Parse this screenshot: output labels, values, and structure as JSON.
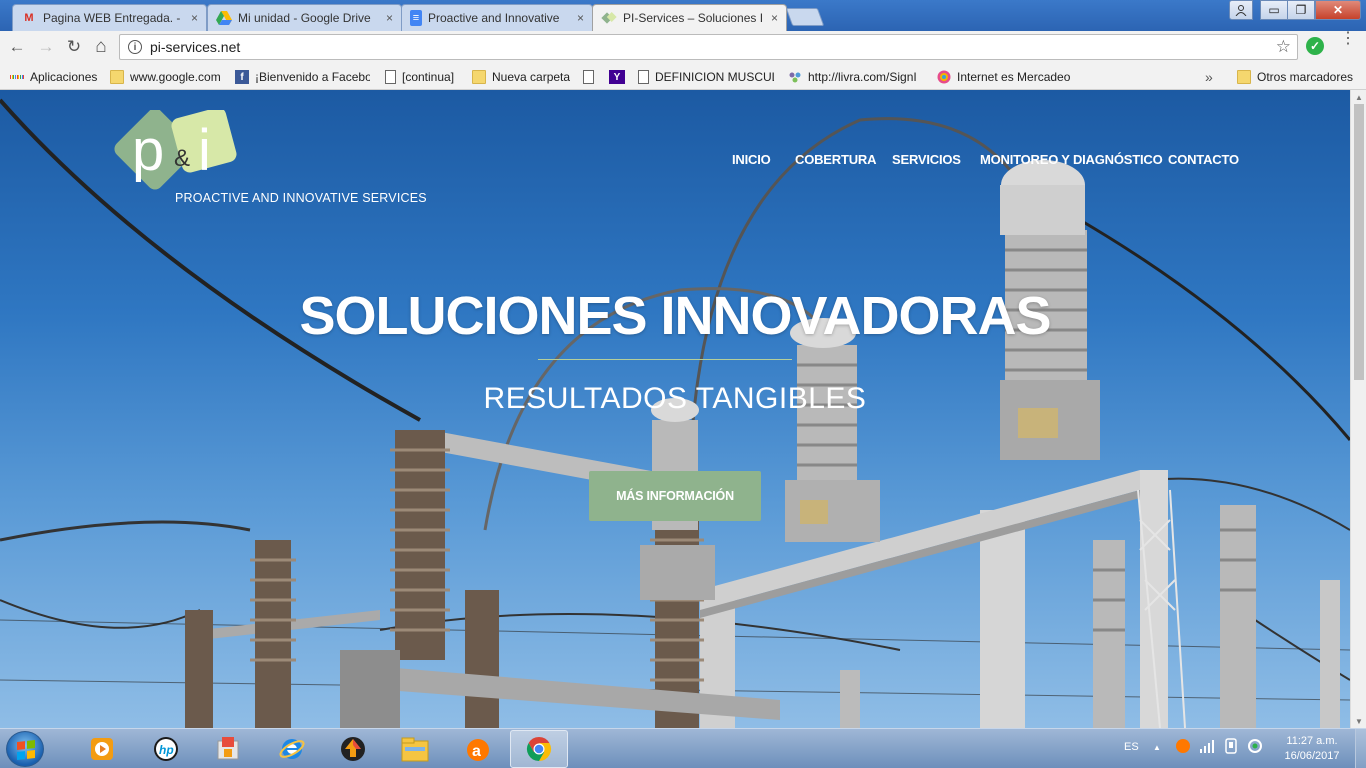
{
  "browser": {
    "tabs": [
      {
        "title": "Pagina WEB Entregada. -",
        "icon": "gmail-icon"
      },
      {
        "title": "Mi unidad - Google Drive",
        "icon": "drive-icon"
      },
      {
        "title": "Proactive and Innovative",
        "icon": "docs-icon"
      },
      {
        "title": "PI-Services – Soluciones I",
        "icon": "site-favicon"
      }
    ],
    "close_glyph": "×",
    "window_controls": {
      "minimize": "▭",
      "restore": "❐",
      "close": "✕"
    },
    "toolbar": {
      "back": "←",
      "forward": "→",
      "reload": "↻",
      "home": "⌂",
      "url": "pi-services.net",
      "info_glyph": "i",
      "star_glyph": "☆",
      "ext_glyph": "✓",
      "menu_glyph": "⋮"
    },
    "bookmarks": [
      {
        "label": "Aplicaciones",
        "icon": "apps-grid-icon"
      },
      {
        "label": "www.google.com",
        "icon": "folder-icon"
      },
      {
        "label": "¡Bienvenido a Faceboo",
        "icon": "facebook-icon"
      },
      {
        "label": "[continua]",
        "icon": "page-icon"
      },
      {
        "label": "Nueva carpeta",
        "icon": "folder-icon"
      },
      {
        "label": "",
        "icon": "yahoo-icon"
      },
      {
        "label": "DEFINICION MUSCUL",
        "icon": "page-icon"
      },
      {
        "label": "http://livra.com/SignI",
        "icon": "livra-icon"
      },
      {
        "label": "Internet es Mercadeo",
        "icon": "mercadeo-icon"
      }
    ],
    "bookmarks_overflow": "»",
    "other_bookmarks": "Otros marcadores",
    "icon_letters": {
      "facebook": "f",
      "yahoo": "Y"
    }
  },
  "site": {
    "logo_text_p": "p",
    "logo_text_amp": "&",
    "logo_text_i": "i",
    "tagline": "PROACTIVE AND INNOVATIVE SERVICES",
    "nav": [
      "INICIO",
      "COBERTURA",
      "SERVICIOS",
      "MONITOREO Y DIAGNÓSTICO",
      "CONTACTO"
    ],
    "hero_title": "SOLUCIONES INNOVADORAS",
    "hero_subtitle": "RESULTADOS TANGIBLES",
    "cta": "MÁS INFORMACIÓN",
    "colors": {
      "accent_green": "#8fb38d",
      "logo_green": "#8fb38d",
      "logo_light": "#d7e8a8",
      "sky_top": "#1c5aa3",
      "sky_bottom": "#8fbde6"
    }
  },
  "scroll": {
    "up": "▲",
    "down": "▼"
  },
  "taskbar": {
    "icons": [
      "media-player-icon",
      "hp-icon",
      "tool-icon",
      "internet-explorer-icon",
      "update-icon",
      "file-explorer-icon",
      "avast-icon",
      "chrome-icon"
    ],
    "language": "ES",
    "tray_arrow": "▲",
    "time": "11:27 a.m.",
    "date": "16/06/2017"
  }
}
